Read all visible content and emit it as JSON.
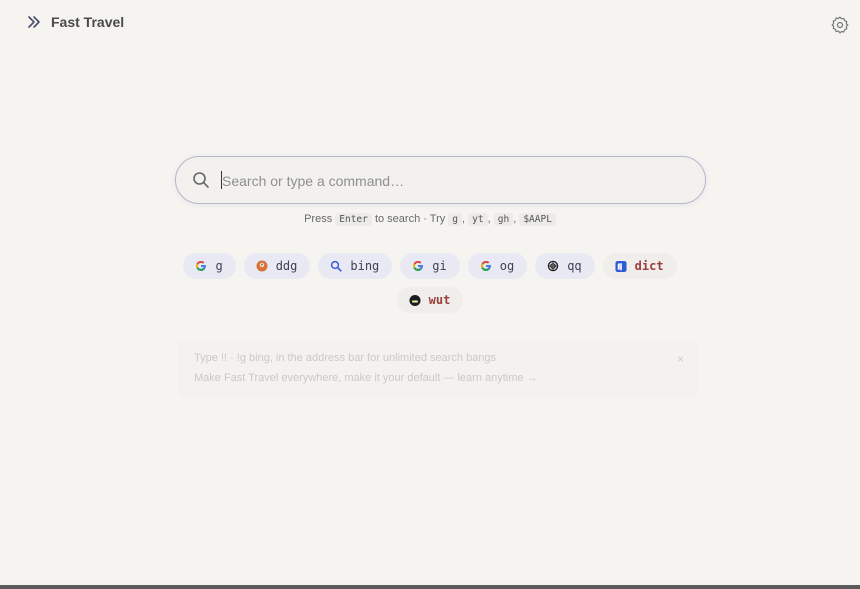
{
  "header": {
    "title": "Fast Travel",
    "menu_icon": "chevrons-right-icon",
    "settings_icon": "gear-icon"
  },
  "search": {
    "placeholder": "Search or type a command…",
    "value": ""
  },
  "hint": {
    "press": "Press",
    "key": "Enter",
    "to_search": "to search · Try",
    "examples": [
      "g",
      "yt",
      "gh",
      "$AAPL"
    ],
    "sep": ","
  },
  "shortcuts": [
    {
      "label": "g",
      "icon": "google-icon"
    },
    {
      "label": "ddg",
      "icon": "duckduckgo-icon"
    },
    {
      "label": "bing",
      "icon": "search-icon"
    },
    {
      "label": "gi",
      "icon": "google-icon"
    },
    {
      "label": "og",
      "icon": "google-icon"
    },
    {
      "label": "qq",
      "icon": "openai-icon"
    },
    {
      "label": "dict",
      "icon": "dictionary-icon"
    },
    {
      "label": "wut",
      "icon": "urban-dictionary-icon"
    }
  ],
  "notice": {
    "line1": "Type  !!  · !g bing, in the address bar for unlimited search bangs",
    "line2": "Make Fast Travel everywhere, make it your default — learn anytime →",
    "close": "×"
  },
  "colors": {
    "accent": "#b8b5cc",
    "chip_bg": "#e8e9f3",
    "background": "#f5f4f1"
  }
}
